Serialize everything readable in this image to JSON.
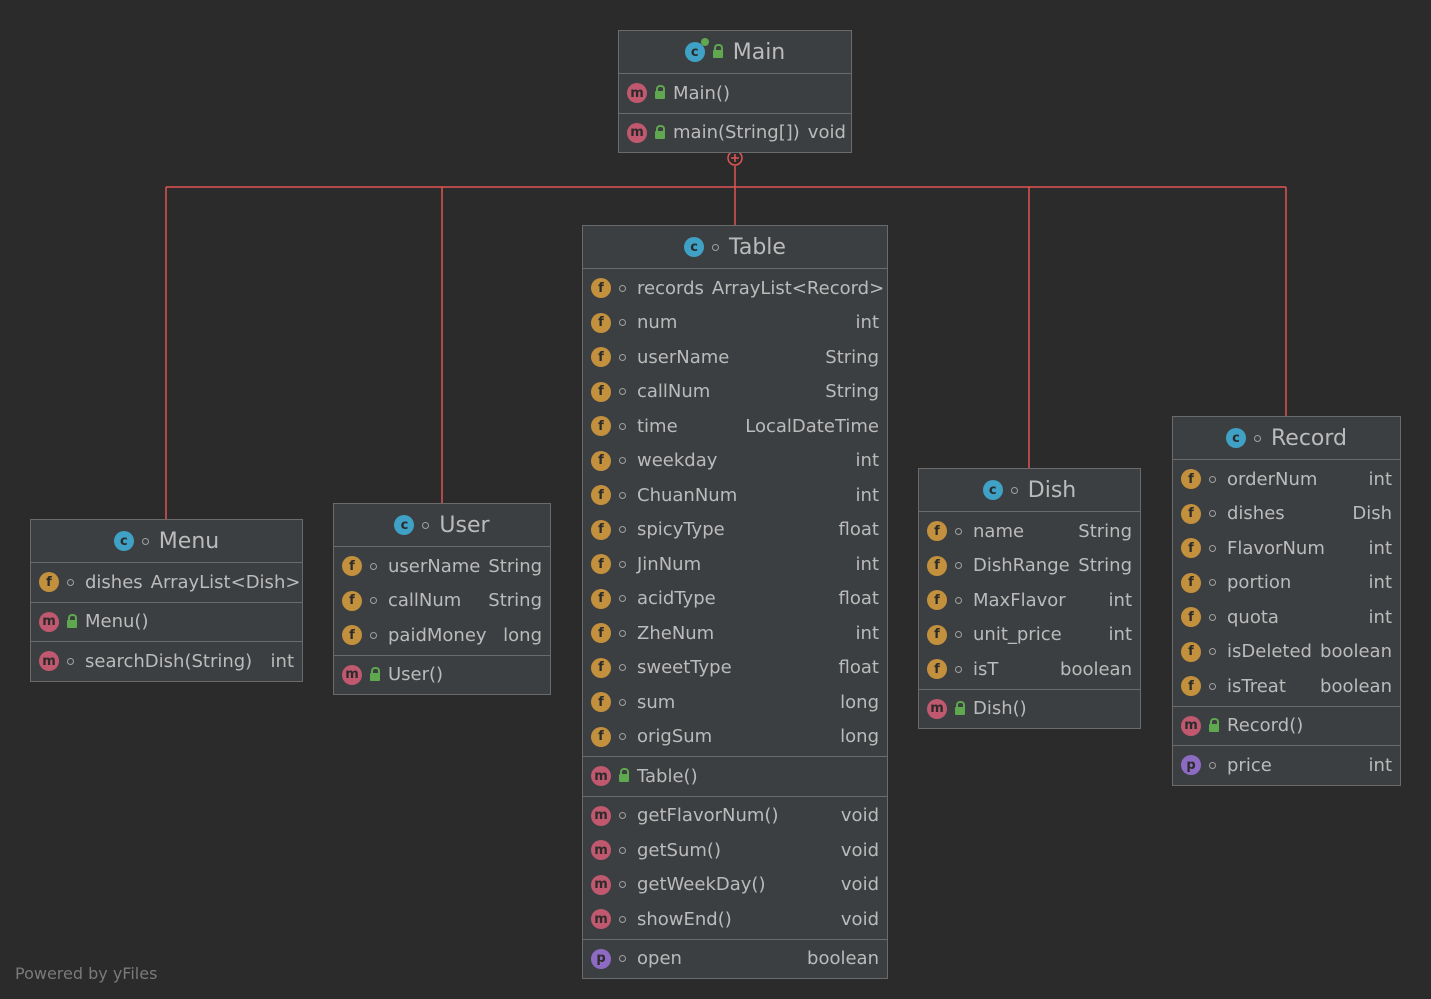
{
  "footer": {
    "powered_by": "Powered by yFiles"
  },
  "colors": {
    "background": "#2b2b2b",
    "box": "#3c3f41",
    "connector": "#e05555",
    "field": "#c3913d",
    "method": "#c0586f",
    "property": "#8d6bc3",
    "class": "#3fa1c5"
  },
  "classes": {
    "main": {
      "name": "Main",
      "sections": [
        [
          {
            "kind": "m",
            "vis": "pub",
            "name": "Main()",
            "type": ""
          }
        ],
        [
          {
            "kind": "m",
            "vis": "pub",
            "name": "main(String[])",
            "type": "void"
          }
        ]
      ]
    },
    "menu": {
      "name": "Menu",
      "sections": [
        [
          {
            "kind": "f",
            "vis": "pkg",
            "name": "dishes",
            "type": "ArrayList<Dish>"
          }
        ],
        [
          {
            "kind": "m",
            "vis": "pub",
            "name": "Menu()",
            "type": ""
          }
        ],
        [
          {
            "kind": "m",
            "vis": "pkg",
            "name": "searchDish(String)",
            "type": "int"
          }
        ]
      ]
    },
    "user": {
      "name": "User",
      "sections": [
        [
          {
            "kind": "f",
            "vis": "pkg",
            "name": "userName",
            "type": "String"
          },
          {
            "kind": "f",
            "vis": "pkg",
            "name": "callNum",
            "type": "String"
          },
          {
            "kind": "f",
            "vis": "pkg",
            "name": "paidMoney",
            "type": "long"
          }
        ],
        [
          {
            "kind": "m",
            "vis": "pub",
            "name": "User()",
            "type": ""
          }
        ]
      ]
    },
    "table": {
      "name": "Table",
      "sections": [
        [
          {
            "kind": "f",
            "vis": "pkg",
            "name": "records",
            "type": "ArrayList<Record>"
          },
          {
            "kind": "f",
            "vis": "pkg",
            "name": "num",
            "type": "int"
          },
          {
            "kind": "f",
            "vis": "pkg",
            "name": "userName",
            "type": "String"
          },
          {
            "kind": "f",
            "vis": "pkg",
            "name": "callNum",
            "type": "String"
          },
          {
            "kind": "f",
            "vis": "pkg",
            "name": "time",
            "type": "LocalDateTime"
          },
          {
            "kind": "f",
            "vis": "pkg",
            "name": "weekday",
            "type": "int"
          },
          {
            "kind": "f",
            "vis": "pkg",
            "name": "ChuanNum",
            "type": "int"
          },
          {
            "kind": "f",
            "vis": "pkg",
            "name": "spicyType",
            "type": "float"
          },
          {
            "kind": "f",
            "vis": "pkg",
            "name": "JinNum",
            "type": "int"
          },
          {
            "kind": "f",
            "vis": "pkg",
            "name": "acidType",
            "type": "float"
          },
          {
            "kind": "f",
            "vis": "pkg",
            "name": "ZheNum",
            "type": "int"
          },
          {
            "kind": "f",
            "vis": "pkg",
            "name": "sweetType",
            "type": "float"
          },
          {
            "kind": "f",
            "vis": "pkg",
            "name": "sum",
            "type": "long"
          },
          {
            "kind": "f",
            "vis": "pkg",
            "name": "origSum",
            "type": "long"
          }
        ],
        [
          {
            "kind": "m",
            "vis": "pub",
            "name": "Table()",
            "type": ""
          }
        ],
        [
          {
            "kind": "m",
            "vis": "pkg",
            "name": "getFlavorNum()",
            "type": "void"
          },
          {
            "kind": "m",
            "vis": "pkg",
            "name": "getSum()",
            "type": "void"
          },
          {
            "kind": "m",
            "vis": "pkg",
            "name": "getWeekDay()",
            "type": "void"
          },
          {
            "kind": "m",
            "vis": "pkg",
            "name": "showEnd()",
            "type": "void"
          }
        ],
        [
          {
            "kind": "p",
            "vis": "pkg",
            "name": "open",
            "type": "boolean"
          }
        ]
      ]
    },
    "dish": {
      "name": "Dish",
      "sections": [
        [
          {
            "kind": "f",
            "vis": "pkg",
            "name": "name",
            "type": "String"
          },
          {
            "kind": "f",
            "vis": "pkg",
            "name": "DishRange",
            "type": "String"
          },
          {
            "kind": "f",
            "vis": "pkg",
            "name": "MaxFlavor",
            "type": "int"
          },
          {
            "kind": "f",
            "vis": "pkg",
            "name": "unit_price",
            "type": "int"
          },
          {
            "kind": "f",
            "vis": "pkg",
            "name": "isT",
            "type": "boolean"
          }
        ],
        [
          {
            "kind": "m",
            "vis": "pub",
            "name": "Dish()",
            "type": ""
          }
        ]
      ]
    },
    "record": {
      "name": "Record",
      "sections": [
        [
          {
            "kind": "f",
            "vis": "pkg",
            "name": "orderNum",
            "type": "int"
          },
          {
            "kind": "f",
            "vis": "pkg",
            "name": "dishes",
            "type": "Dish"
          },
          {
            "kind": "f",
            "vis": "pkg",
            "name": "FlavorNum",
            "type": "int"
          },
          {
            "kind": "f",
            "vis": "pkg",
            "name": "portion",
            "type": "int"
          },
          {
            "kind": "f",
            "vis": "pkg",
            "name": "quota",
            "type": "int"
          },
          {
            "kind": "f",
            "vis": "pkg",
            "name": "isDeleted",
            "type": "boolean"
          },
          {
            "kind": "f",
            "vis": "pkg",
            "name": "isTreat",
            "type": "boolean"
          }
        ],
        [
          {
            "kind": "m",
            "vis": "pub",
            "name": "Record()",
            "type": ""
          }
        ],
        [
          {
            "kind": "p",
            "vis": "pkg",
            "name": "price",
            "type": "int"
          }
        ]
      ]
    }
  }
}
